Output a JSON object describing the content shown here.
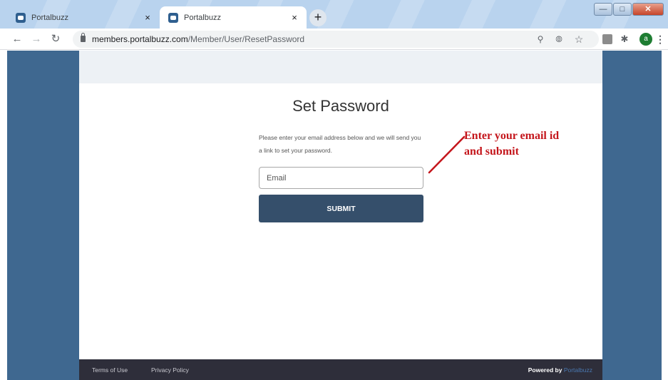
{
  "browser": {
    "tabs": [
      {
        "title": "Portalbuzz",
        "active": false
      },
      {
        "title": "Portalbuzz",
        "active": true
      }
    ],
    "tab_close_glyph": "×",
    "new_tab_glyph": "+",
    "url_host": "members.portalbuzz.com",
    "url_path": "/Member/User/ResetPassword",
    "profile_initial": "a",
    "icons": [
      "back-arrow-icon",
      "forward-arrow-icon",
      "reload-icon",
      "lock-icon",
      "zoom-icon",
      "eye-off-icon",
      "star-icon",
      "pdf-extension-icon",
      "puzzle-icon",
      "kebab-menu-icon"
    ]
  },
  "page": {
    "heading": "Set Password",
    "instructions": "Please enter your email address below and we will send you a link to set your password.",
    "email_placeholder": "Email",
    "submit_label": "SUBMIT",
    "footer": {
      "terms": "Terms of Use",
      "privacy": "Privacy Policy",
      "powered_by": "Powered by",
      "brand": "Portalbuzz"
    }
  },
  "annotation": {
    "line1": "Enter your email id",
    "line2": "and submit",
    "color": "#c4161c"
  },
  "colors": {
    "page_background": "#3f6890",
    "button": "#354f6b",
    "footer": "#2e2e3a"
  }
}
